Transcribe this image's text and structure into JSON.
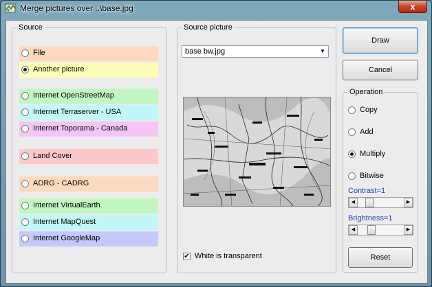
{
  "window": {
    "title": "Merge pictures over ..\\base.jpg",
    "close_glyph": "x"
  },
  "source": {
    "legend": "Source",
    "options": [
      {
        "label": "File",
        "checked": false,
        "color": "#fdd9c0"
      },
      {
        "label": "Another picture",
        "checked": true,
        "color": "#fefdb8"
      },
      {
        "label": "Internet OpenStreetMap",
        "checked": false,
        "color": "#c1f6c1"
      },
      {
        "label": "Internet Terraserver - USA",
        "checked": false,
        "color": "#c1f7f7"
      },
      {
        "label": "Internet Toporama - Canada",
        "checked": false,
        "color": "#f3c6f5"
      },
      {
        "label": "Land Cover",
        "checked": false,
        "color": "#fdc8c8"
      },
      {
        "label": "ADRG - CADRG",
        "checked": false,
        "color": "#fdd9c0"
      },
      {
        "label": "Internet VirtualEarth",
        "checked": false,
        "color": "#c1f6c1"
      },
      {
        "label": "Internet MapQuest",
        "checked": false,
        "color": "#c1f7f7"
      },
      {
        "label": "Internet GoogleMap",
        "checked": false,
        "color": "#c4c8fa"
      }
    ]
  },
  "source_picture": {
    "legend": "Source picture",
    "selected": "base bw.jpg",
    "white_transparent_label": "White is transparent",
    "white_transparent_checked": true
  },
  "buttons": {
    "draw": "Draw",
    "cancel": "Cancel",
    "reset": "Reset"
  },
  "operation": {
    "legend": "Operation",
    "options": [
      {
        "label": "Copy",
        "checked": false
      },
      {
        "label": "Add",
        "checked": false
      },
      {
        "label": "Multiply",
        "checked": true
      },
      {
        "label": "Bitwise",
        "checked": false
      }
    ],
    "contrast_label": "Contrast=1",
    "contrast_value": 0.2,
    "brightness_label": "Brightness=1",
    "brightness_value": 0.25
  }
}
